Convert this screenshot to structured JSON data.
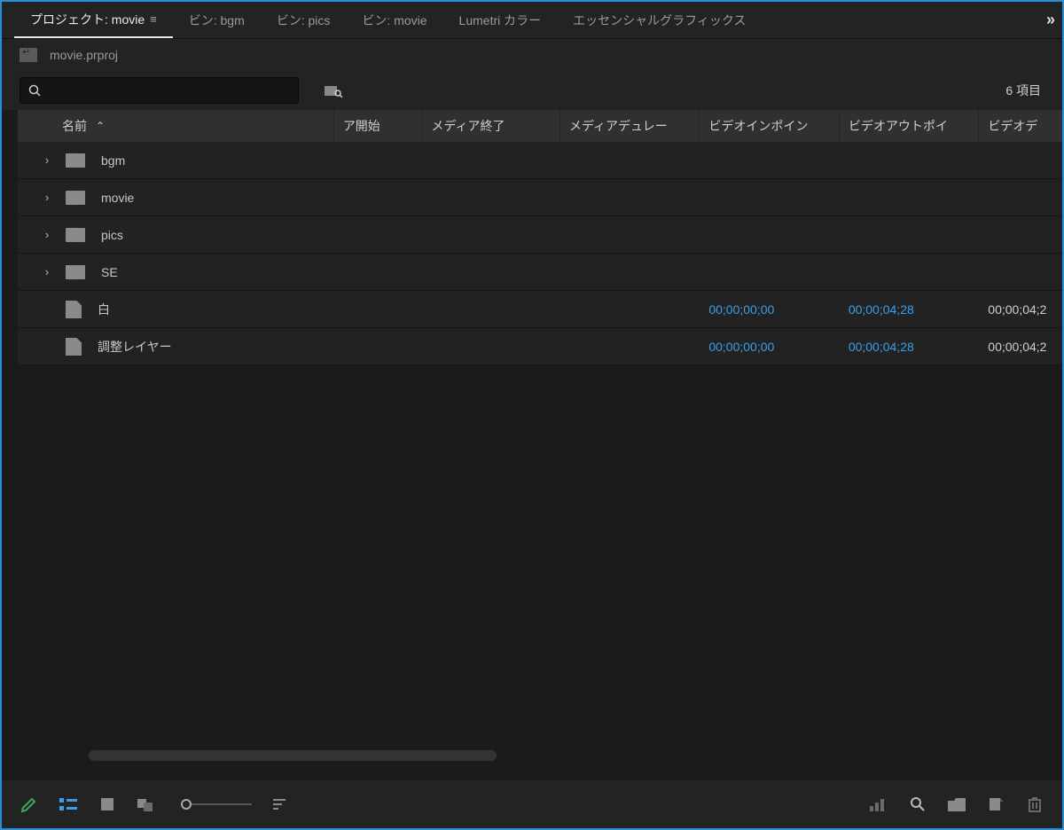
{
  "tabs": [
    {
      "label": "プロジェクト: movie",
      "active": true
    },
    {
      "label": "ビン: bgm",
      "active": false
    },
    {
      "label": "ビン: pics",
      "active": false
    },
    {
      "label": "ビン: movie",
      "active": false
    },
    {
      "label": "Lumetri カラー",
      "active": false
    },
    {
      "label": "エッセンシャルグラフィックス",
      "active": false
    }
  ],
  "overflow_glyph": "»",
  "breadcrumb": {
    "file": "movie.prproj"
  },
  "item_count": "6 項目",
  "columns": {
    "name": "名前",
    "c2": "ア開始",
    "c3": "メディア終了",
    "c4": "メディアデュレー",
    "c5": "ビデオインポイン",
    "c6": "ビデオアウトポイ",
    "c7": "ビデオデ"
  },
  "rows": [
    {
      "type": "folder",
      "name": "bgm"
    },
    {
      "type": "folder",
      "name": "movie"
    },
    {
      "type": "folder",
      "name": "pics"
    },
    {
      "type": "folder",
      "name": "SE"
    },
    {
      "type": "item",
      "name": "白",
      "in": "00;00;00;00",
      "out": "00;00;04;28",
      "dur": "00;00;04;2"
    },
    {
      "type": "item",
      "name": "調整レイヤー",
      "in": "00;00;00;00",
      "out": "00;00;04;28",
      "dur": "00;00;04;2"
    }
  ],
  "sort_caret": "⌃"
}
